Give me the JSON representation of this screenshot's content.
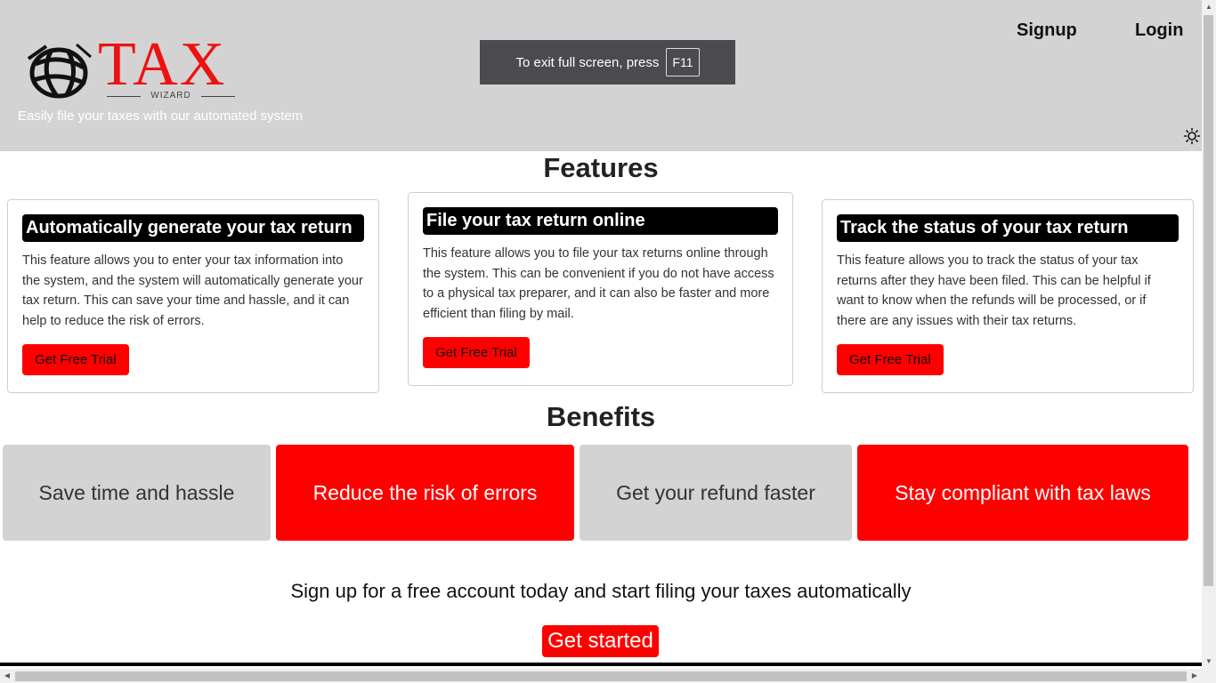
{
  "header": {
    "logo": {
      "word": "TAX",
      "sub": "WIZARD"
    },
    "tagline": "Easily file your taxes with our automated system",
    "nav": {
      "signup": "Signup",
      "login": "Login"
    },
    "fullscreen_notice": {
      "text": "To exit full screen, press",
      "key": "F11"
    }
  },
  "features": {
    "title": "Features",
    "cards": [
      {
        "heading": "Automatically generate your tax return",
        "desc": "This feature allows you to enter your tax information into the system, and the system will automatically generate your tax return. This can save your time and hassle, and it can help to reduce the risk of errors.",
        "button": "Get Free Trial"
      },
      {
        "heading": "File your tax return online",
        "desc": "This feature allows you to file your tax returns online through the system. This can be convenient if you do not have access to a physical tax preparer, and it can also be faster and more efficient than filing by mail.",
        "button": "Get Free Trial"
      },
      {
        "heading": "Track the status of your tax return",
        "desc": "This feature allows you to track the status of your tax returns after they have been filed. This can be helpful if want to know when the refunds will be processed, or if there are any issues with their tax returns.",
        "button": "Get Free Trial"
      }
    ]
  },
  "benefits": {
    "title": "Benefits",
    "items": [
      "Save time and hassle",
      "Reduce the risk of errors",
      "Get your refund faster",
      "Stay compliant with tax laws"
    ]
  },
  "cta": {
    "text": "Sign up for a free account today and start filing your taxes automatically",
    "button": "Get started"
  },
  "colors": {
    "accent": "#ff0000",
    "header_bg": "#d3d3d3",
    "logo_red": "#ee1111"
  }
}
